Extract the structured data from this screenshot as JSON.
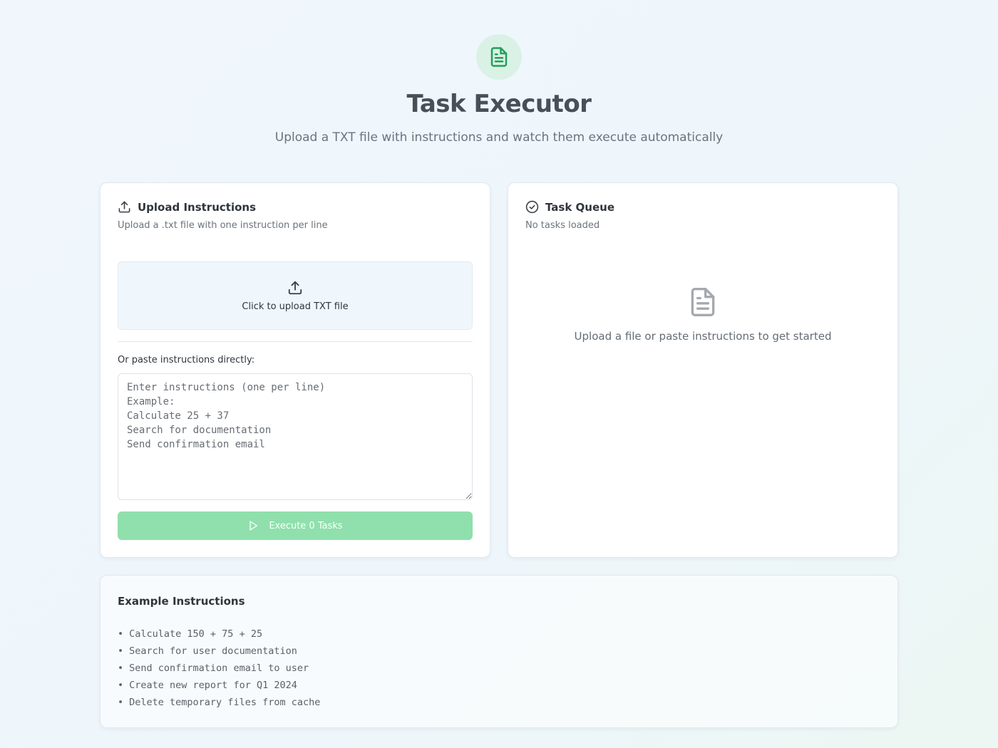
{
  "header": {
    "title": "Task Executor",
    "subtitle": "Upload a TXT file with instructions and watch them execute automatically",
    "icon": "file-text-icon"
  },
  "upload_card": {
    "title": "Upload Instructions",
    "description": "Upload a .txt file with one instruction per line",
    "drop_zone_label": "Click to upload TXT file",
    "paste_label": "Or paste instructions directly:",
    "textarea_value": "",
    "textarea_placeholder": "Enter instructions (one per line)\nExample:\nCalculate 25 + 37\nSearch for documentation\nSend confirmation email",
    "execute_label": "Execute 0 Tasks",
    "execute_disabled": true
  },
  "queue_card": {
    "title": "Task Queue",
    "description": "No tasks loaded",
    "empty_message": "Upload a file or paste instructions to get started"
  },
  "examples_card": {
    "title": "Example Instructions",
    "bullet": "•",
    "items": [
      "Calculate 150 + 75 + 25",
      "Search for user documentation",
      "Send confirmation email to user",
      "Create new report for Q1 2024",
      "Delete temporary files from cache"
    ]
  },
  "colors": {
    "accent": "#22c55e",
    "accent_light": "#daf2e6",
    "button_disabled": "#8fe0ac"
  }
}
